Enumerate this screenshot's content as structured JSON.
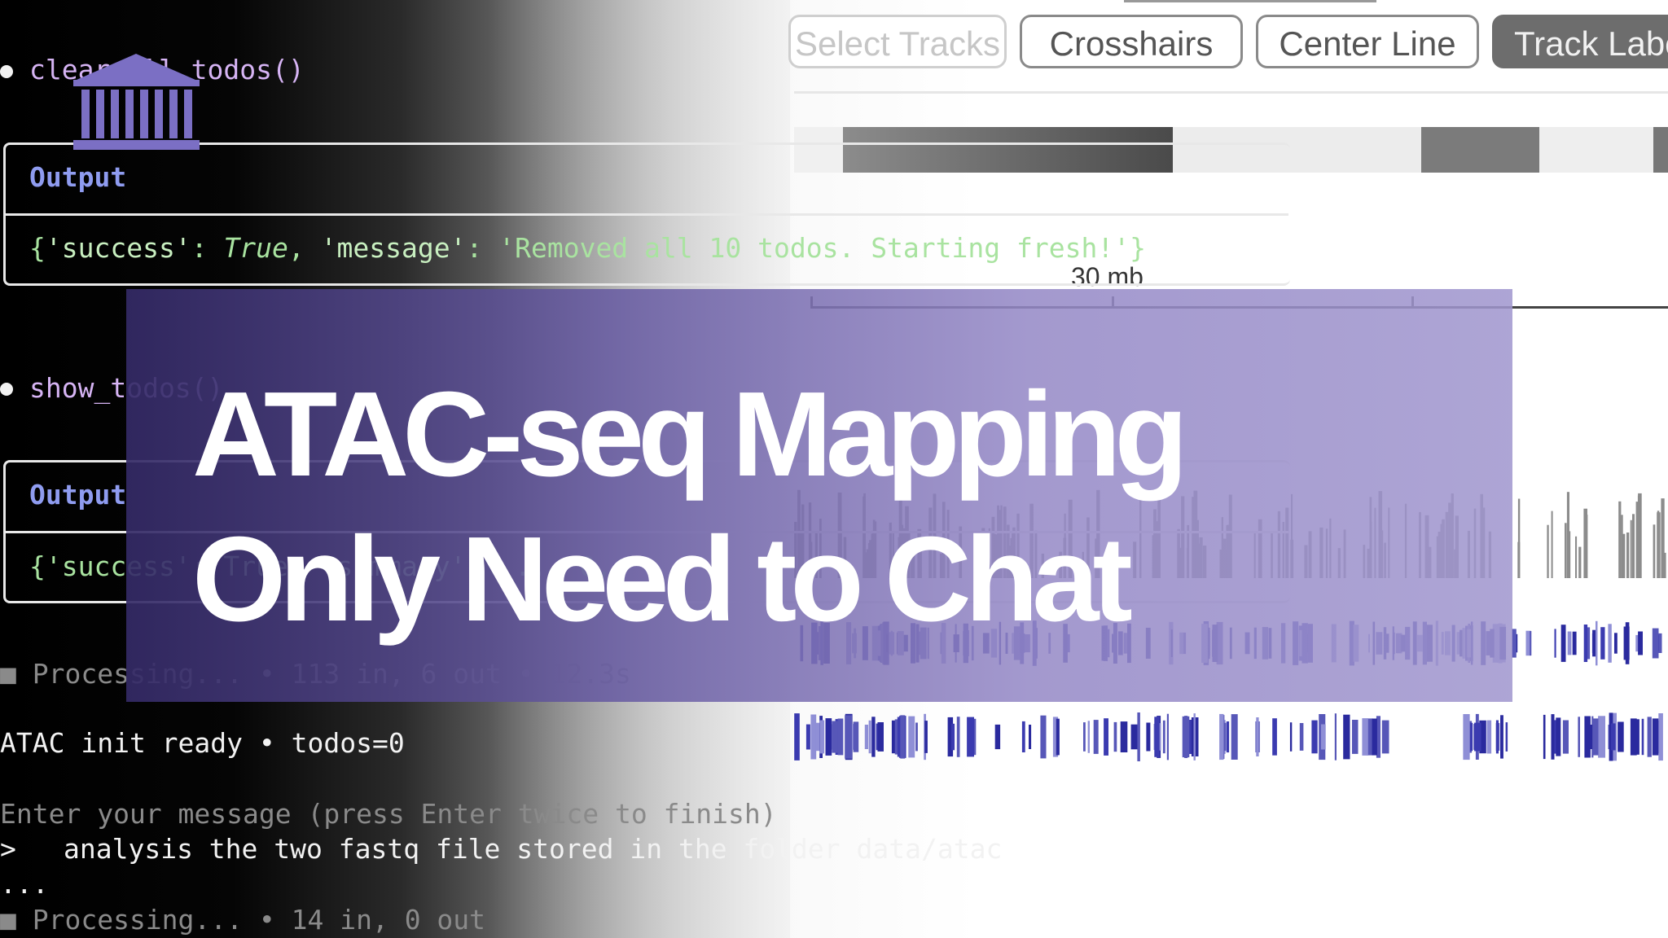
{
  "toolbar": {
    "buttons": [
      {
        "label": "Select Tracks"
      },
      {
        "label": "Crosshairs"
      },
      {
        "label": "Center Line"
      },
      {
        "label": "Track Labe"
      }
    ]
  },
  "ruler": {
    "label": "30 mb"
  },
  "terminal": {
    "blocks": [
      {
        "call": "clear_all_todos()",
        "output_label": "Output",
        "result": {
          "open": "{",
          "key1": "'success'",
          "sep1": ": ",
          "val1": "True",
          "sep2": ", ",
          "key2": "'message'",
          "sep3": ": ",
          "val2": "'Removed all 10 todos. Starting fresh!'",
          "close": "}"
        }
      },
      {
        "call": "show_todos()",
        "output_label": "Output",
        "result_text": "{'success': True, 'summary': ..., 0,"
      }
    ],
    "processing_1": "■ Processing... • 113 in, 6 out • 12.3s",
    "ready_line": "ATAC init ready • todos=0",
    "prompt_hint": "Enter your message (press Enter twice to finish)",
    "prompt_marker": ">",
    "user_message": "analysis the two fastq file stored in the folder data/atac",
    "continuation": "...",
    "processing_2": "■ Processing... • 14 in, 0 out"
  },
  "banner": {
    "line1": "ATAC-seq Mapping",
    "line2": "Only Need to Chat"
  },
  "icons": {
    "logo": "temple-icon"
  },
  "colors": {
    "banner_accent": "#8a7fc6",
    "track_dark": "#2a2a9e",
    "function_name": "#d6b4f4",
    "output_label": "#8f9cf0",
    "result_text": "#a9e3a0"
  }
}
